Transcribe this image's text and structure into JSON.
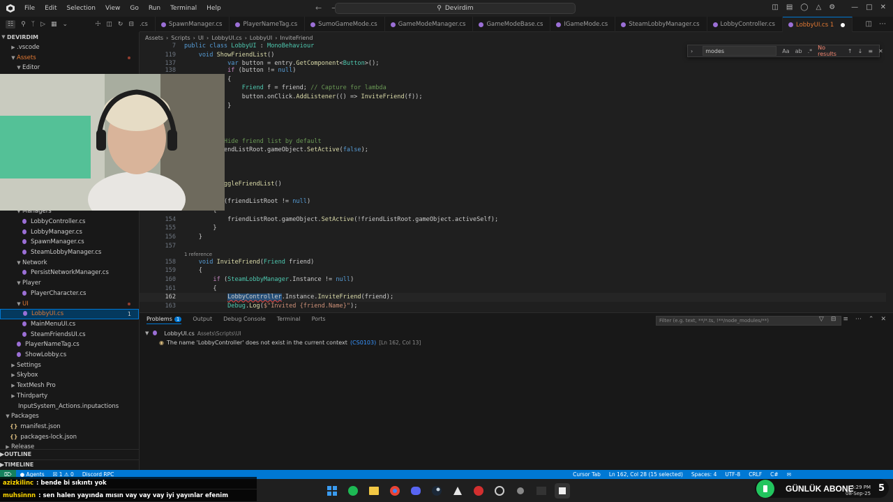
{
  "menu": [
    "File",
    "Edit",
    "Selection",
    "View",
    "Go",
    "Run",
    "Terminal",
    "Help"
  ],
  "command_center": "Devirdim",
  "explorer": {
    "root": "DEVIRDIM",
    "items": [
      {
        "label": ".vscode",
        "indent": 1,
        "type": "folder",
        "open": false
      },
      {
        "label": "Assets",
        "indent": 1,
        "type": "folder",
        "open": true,
        "color": "#e37933",
        "dot": true
      },
      {
        "label": "Editor",
        "indent": 2,
        "type": "folder",
        "open": true
      }
    ],
    "lower_items": [
      {
        "label": "Managers",
        "indent": 2,
        "type": "folder",
        "open": true
      },
      {
        "label": "LobbyController.cs",
        "indent": 3,
        "type": "cs"
      },
      {
        "label": "LobbyManager.cs",
        "indent": 3,
        "type": "cs"
      },
      {
        "label": "SpawnManager.cs",
        "indent": 3,
        "type": "cs"
      },
      {
        "label": "SteamLobbyManager.cs",
        "indent": 3,
        "type": "cs"
      },
      {
        "label": "Network",
        "indent": 2,
        "type": "folder",
        "open": true
      },
      {
        "label": "PersistNetworkManager.cs",
        "indent": 3,
        "type": "cs"
      },
      {
        "label": "Player",
        "indent": 2,
        "type": "folder",
        "open": true
      },
      {
        "label": "PlayerCharacter.cs",
        "indent": 3,
        "type": "cs"
      },
      {
        "label": "UI",
        "indent": 2,
        "type": "folder",
        "open": true,
        "color": "#e37933",
        "dot": true
      },
      {
        "label": "LobbyUI.cs",
        "indent": 3,
        "type": "cs",
        "selected": true,
        "badge": "1",
        "color": "#e37933"
      },
      {
        "label": "MainMenuUI.cs",
        "indent": 3,
        "type": "cs"
      },
      {
        "label": "SteamFriendsUI.cs",
        "indent": 3,
        "type": "cs"
      },
      {
        "label": "PlayerNameTag.cs",
        "indent": 2,
        "type": "cs"
      },
      {
        "label": "ShowLobby.cs",
        "indent": 2,
        "type": "cs"
      },
      {
        "label": "Settings",
        "indent": 1,
        "type": "folder",
        "open": false
      },
      {
        "label": "Skybox",
        "indent": 1,
        "type": "folder",
        "open": false
      },
      {
        "label": "TextMesh Pro",
        "indent": 1,
        "type": "folder",
        "open": false
      },
      {
        "label": "Thirdparty",
        "indent": 1,
        "type": "folder",
        "open": false
      },
      {
        "label": "InputSystem_Actions.inputactions",
        "indent": 1,
        "type": "file"
      },
      {
        "label": "Packages",
        "indent": 0,
        "type": "folder",
        "open": true
      },
      {
        "label": "manifest.json",
        "indent": 1,
        "type": "json"
      },
      {
        "label": "packages-lock.json",
        "indent": 1,
        "type": "json"
      },
      {
        "label": "Release",
        "indent": 0,
        "type": "folder",
        "open": false
      }
    ],
    "outline": "OUTLINE",
    "timeline": "TIMELINE"
  },
  "tabs": [
    {
      "label": ".cs",
      "active": false
    },
    {
      "label": "SpawnManager.cs",
      "active": false
    },
    {
      "label": "PlayerNameTag.cs",
      "active": false
    },
    {
      "label": "SumoGameMode.cs",
      "active": false
    },
    {
      "label": "GameModeManager.cs",
      "active": false
    },
    {
      "label": "GameModeBase.cs",
      "active": false
    },
    {
      "label": "IGameMode.cs",
      "active": false
    },
    {
      "label": "SteamLobbyManager.cs",
      "active": false
    },
    {
      "label": "LobbyController.cs",
      "active": false
    },
    {
      "label": "LobbyUI.cs 1",
      "active": true
    }
  ],
  "breadcrumb": [
    "Assets",
    "Scripts",
    "UI",
    "LobbyUI.cs",
    "LobbyUI",
    "InviteFriend"
  ],
  "find": {
    "value": "modes",
    "aa": "Aa",
    "ab": "ab",
    "regex": ".*",
    "result": "No results"
  },
  "reference_lens": "1 reference",
  "panel": {
    "tabs": [
      "Problems",
      "Output",
      "Debug Console",
      "Terminal",
      "Ports"
    ],
    "problems_count": "1",
    "filter_placeholder": "Filter (e.g. text, **/*.ts, !**/node_modules/**)",
    "file": "LobbyUI.cs",
    "file_path": "Assets\\Scripts\\UI",
    "file_count": "1",
    "message": "The name 'LobbyController' does not exist in the current context",
    "code": "(CS0103)",
    "location": "[Ln 162, Col 13]"
  },
  "statusbar": {
    "agents": "Agents",
    "errors": "1",
    "warnings": "0",
    "discord": "Discord RPC",
    "cursor_tab": "Cursor Tab",
    "position": "Ln 162, Col 28 (15 selected)",
    "spaces": "Spaces: 4",
    "encoding": "UTF-8",
    "eol": "CRLF",
    "language": "C#"
  },
  "chat": [
    {
      "user": "azizkilinc",
      "text": ": bende bi sıkıntı yok"
    },
    {
      "user": "muhsinnn",
      "text": ": sen halen yayında mısın vay vay vay iyi yayınlar efenim"
    }
  ],
  "subscribe_banner": {
    "text": "GÜNLÜK ABONE",
    "count": "5"
  },
  "clock": {
    "time": "5:29 PM",
    "date": "08-Sep-25"
  }
}
